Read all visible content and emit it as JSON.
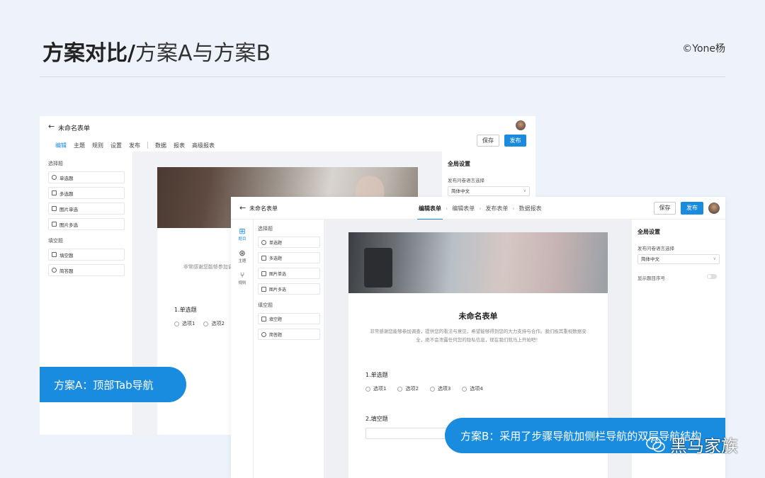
{
  "header": {
    "title_bold": "方案对比/",
    "title_light": "方案A与方案B",
    "copyright": "©Yone杨"
  },
  "colors": {
    "accent": "#1a8ce0",
    "background": "#eef3fb"
  },
  "screen_a": {
    "form_name": "未命名表单",
    "tabs": [
      "编辑",
      "主题",
      "规则",
      "设置",
      "发布",
      "数据",
      "报表",
      "高级报表"
    ],
    "save_label": "保存",
    "publish_label": "发布",
    "left": {
      "section1": "选择题",
      "items1": [
        "单选题",
        "多选题",
        "图片单选",
        "图片多选"
      ],
      "section2": "填空题",
      "items2": [
        "填空题",
        "简答题"
      ]
    },
    "desc": "非常感谢您能够参加调查 们极其重视数据安全",
    "q1": "1.单选题",
    "options": [
      "选项1",
      "选项2"
    ],
    "right": {
      "title": "全局设置",
      "lang_label": "发布问卷语言选择",
      "lang_value": "简体中文"
    }
  },
  "screen_b": {
    "form_name": "未命名表单",
    "steps": [
      "编辑表单",
      "编辑表单",
      "发布表单",
      "数据报表"
    ],
    "save_label": "保存",
    "publish_label": "发布",
    "rail": [
      "题目",
      "主题",
      "规则"
    ],
    "left": {
      "section1": "选择题",
      "items1": [
        "单选题",
        "多选题",
        "图片单选",
        "图片多选"
      ],
      "section2": "填空题",
      "items2": [
        "填空题",
        "简答题"
      ]
    },
    "form_title": "未命名表单",
    "desc": "非常感谢您能够参加调查，提供您的看法与意见，希望能够得到您的大力支持与合作。我们极其重视数据安全，绝不会泄露任何您的隐私信息，现在我们就马上开始吧！",
    "q1": "1.单选题",
    "options": [
      "选项1",
      "选项2",
      "选项3",
      "选项4"
    ],
    "q2": "2.填空题",
    "right": {
      "title": "全局设置",
      "lang_label": "发布问卷语言选择",
      "lang_value": "简体中文",
      "toggle_label": "显示题目序号",
      "toggle_on": false
    }
  },
  "pill_a": "方案A：顶部Tab导航",
  "pill_b": "方案B：采用了步骤导航加侧栏导航的双层导航结构",
  "watermark": "黑马家族"
}
